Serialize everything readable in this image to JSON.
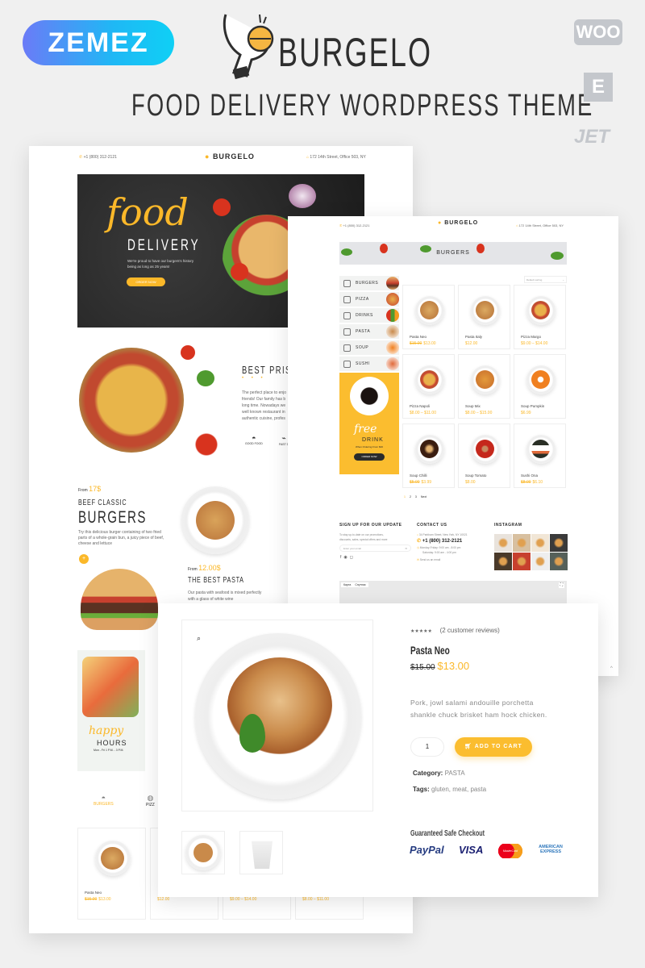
{
  "promo": {
    "vendor_logo": "ZEMEZ",
    "brand_name": "BURGELO",
    "tagline": "FOOD DELIVERY WORDPRESS THEME",
    "side_logos": [
      "WOO",
      "E",
      "JET"
    ]
  },
  "colors": {
    "accent": "#fbb829",
    "background": "#f0f0f0",
    "dark": "#2b2b2b"
  },
  "home_page": {
    "header": {
      "phone": "+1 (800) 312-2121",
      "logo": "BURGELO",
      "address": "172 14th Street, Office 503, NY"
    },
    "hero": {
      "script_title": "food",
      "title": "DELIVERY",
      "subtitle_line1": "We're proud to have our burgers's history",
      "subtitle_line2": "being as long as 25 years!",
      "button": "ORDER NOW"
    },
    "about": {
      "title": "BEST PRIS",
      "lines": [
        "The perfect place to enjo",
        "friends! Our family has b",
        "long time. Nowadays we",
        "well known restaurant in",
        "authentic cuisine, profes"
      ],
      "features": [
        "GOOD FOOD",
        "FAST D"
      ]
    },
    "burgers_promo": {
      "from_label": "From",
      "price": "17$",
      "subtitle": "BEEF CLASSIC",
      "title": "BURGERS",
      "lines": [
        "Try this delicious burger containing of two fried",
        "parts of a whole-grain bun, a juicy piece of beef,",
        "cheese and lettuce"
      ],
      "button": "+"
    },
    "pasta_promo": {
      "from_label": "From",
      "price": "12.00$",
      "title": "THE BEST PASTA",
      "lines": [
        "Our pasta with seafood is mixed perfectly",
        "with a glass of white wine"
      ]
    },
    "happy_hours": {
      "script": "happy",
      "title": "HOURS",
      "time": "Mon - Fri 1 P.M. - 3 P.M."
    },
    "tabs": [
      {
        "label": "BURGERS",
        "active": true
      },
      {
        "label": "PIZZ",
        "active": false
      }
    ],
    "products": [
      {
        "name": "Pasta Neo",
        "old_price": "$15.00",
        "price": "$13.00",
        "image": "pasta-plate"
      },
      {
        "name": "",
        "old_price": "",
        "price": "$12.00",
        "image": "pasta-plate"
      },
      {
        "name": "",
        "old_price": "",
        "price": "$9.00 – $14.00",
        "image": "pizza"
      },
      {
        "name": "",
        "old_price": "",
        "price": "$8.00 – $11.00",
        "image": "pizza"
      }
    ]
  },
  "shop_page": {
    "header": {
      "phone": "+1 (800) 312-2121",
      "logo": "BURGELO",
      "address": "172 14th Street, Office 503, NY"
    },
    "banner_title": "BURGERS",
    "categories": [
      "BURGERS",
      "PIZZA",
      "DRINKS",
      "PASTA",
      "SOUP",
      "SUSHI"
    ],
    "promo": {
      "script": "free",
      "title": "DRINK",
      "subtitle": "When Ordering From $30",
      "button": "ORDER NOW"
    },
    "sort": {
      "selected": "Default sorting"
    },
    "products": [
      {
        "name": "Pasta Neo",
        "old_price": "$15.00",
        "price": "$13.00",
        "image": "pasta-plate"
      },
      {
        "name": "Pasta Italy",
        "old_price": "",
        "price": "$12.00",
        "image": "pasta-plate"
      },
      {
        "name": "Pizza Margo",
        "old_price": "",
        "price": "$9.00 – $14.00",
        "image": "pizza"
      },
      {
        "name": "Pizza Napoli",
        "old_price": "",
        "price": "$8.00 – $11.00",
        "image": "pizza"
      },
      {
        "name": "Soup Mix",
        "old_price": "",
        "price": "$8.00 – $15.00",
        "image": "soup"
      },
      {
        "name": "Soup Pumpkin",
        "old_price": "",
        "price": "$6.99",
        "image": "pumpkin-soup"
      },
      {
        "name": "Soup Chilli",
        "old_price": "$5.00",
        "price": "$3.99",
        "image": "dark-soup"
      },
      {
        "name": "Soup Tomato",
        "old_price": "",
        "price": "$8.00",
        "image": "tomato-soup"
      },
      {
        "name": "Sushi Ona",
        "old_price": "$8.00",
        "price": "$6.10",
        "image": "sushi"
      }
    ],
    "pagination": [
      "1",
      "2",
      "3",
      "Next"
    ],
    "footer": {
      "signup_title": "SIGN UP FOR OUR UPDATE",
      "signup_text_1": "To stay up-to-date on our promotions,",
      "signup_text_2": "discounts, sales, special offers and more",
      "email_placeholder": "Enter your email",
      "contact_title": "CONTACT US",
      "address": "34 Parkham Street, New York, NY 10021",
      "phone": "+1 (800) 312-2121",
      "hours_1": "Monday-Friday: 9:00 am - 8:00 pm",
      "hours_2": "Saturday: 9:00 am - 4:00 pm",
      "email_link": "Send us an email",
      "instagram_title": "INSTAGRAM"
    },
    "map": {
      "tab_map": "Карта",
      "tab_satellite": "Спутник"
    }
  },
  "product_page": {
    "rating": 5,
    "reviews": "(2 customer reviews)",
    "name": "Pasta Neo",
    "old_price": "$15.00",
    "price": "$13.00",
    "description_1": "Pork, jowl salami andouille porchetta",
    "description_2": "shankle chuck brisket ham hock chicken.",
    "quantity": "1",
    "add_to_cart": "ADD TO CART",
    "category_label": "Category:",
    "category": "PASTA",
    "tags_label": "Tags:",
    "tags": "gluten, meat, pasta",
    "checkout_title": "Guaranteed Safe Checkout",
    "payments": [
      "PayPal",
      "VISA",
      "MasterCard",
      "AMERICAN EXPRESS"
    ]
  }
}
